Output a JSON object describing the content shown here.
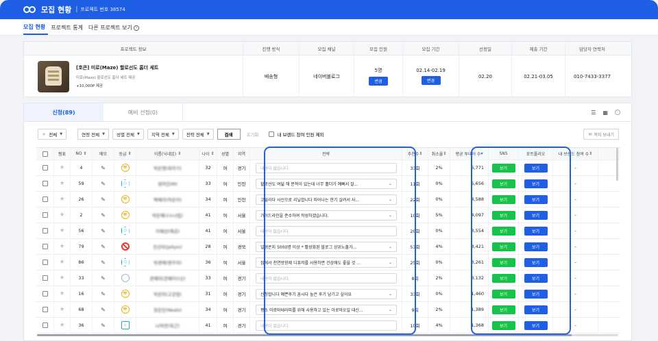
{
  "header": {
    "title": "모집 현황",
    "separator": "|",
    "project_no": "프로젝트 번호 38574"
  },
  "nav": {
    "tabs": [
      {
        "label": "모집 현황"
      },
      {
        "label": "프로젝트 통계"
      },
      {
        "label": "다른 프로젝트 보기"
      }
    ],
    "more_icon": "chevron-right-circle-icon"
  },
  "info": {
    "headers": [
      "프로젝트 정보",
      "진행 방식",
      "모집 채널",
      "모집 인원",
      "모집 기간",
      "선정일",
      "제출 기간",
      "담당자 연락처"
    ],
    "product_name": "[호큰] 미로(Maze) 할로선도 홈더 세트",
    "product_sub": "미로(Maze) 할로선도 홈더 세트 제공",
    "product_point": "+10,000P 제공",
    "method": "배송형",
    "channel": "네이버블로그",
    "recruit": "5명",
    "recruit_btn": "변경",
    "period": "02.14-02.19",
    "period_btn": "변경",
    "select_date": "02.20",
    "submit_period": "02.21-03.05",
    "contact": "010-7433-3377"
  },
  "tabs": {
    "apply": "신청(89)",
    "preselect": "예비 선정(0)",
    "icons": [
      "list-view-icon",
      "grid-view-icon",
      "info-icon"
    ]
  },
  "filters": {
    "fav": "전체",
    "connect": "연령 전체",
    "gender": "성별 전체",
    "region": "지역 전체",
    "reason": "전략 전체",
    "search": "검색",
    "reset": "초기화",
    "exclude": "내 브랜드 참여 인원 제외",
    "message": "쪽지 보내기"
  },
  "columns": [
    "",
    "찜표",
    "NO",
    "메모",
    "등급",
    "이름(닉네임)",
    "나이",
    "성별",
    "지역",
    "전략",
    "추천수",
    "취소율",
    "평균 투데이 수",
    "SNS",
    "포트폴리오",
    "내 브랜드 참여 수"
  ],
  "rows": [
    {
      "no": "4",
      "grade": "gold",
      "name": "박은영(육아기)",
      "age": "32",
      "sex": "여",
      "region": "경기",
      "reason": "내용이 없습니다.",
      "empty": true,
      "rec": "33회",
      "cancel": "2%",
      "avg": "6,771",
      "sns": "보기",
      "pf": "보기",
      "brand": "-"
    },
    {
      "no": "59",
      "grade": "teal",
      "name": "정여진(M)",
      "age": "33",
      "sex": "여",
      "region": "인천",
      "reason": "할로선도 여덟 해 분적이 있는데 너무 홀더가 예뻐서 잘...",
      "empty": false,
      "rec": "11회",
      "cancel": "0%",
      "avg": "5,656",
      "sns": "보기",
      "pf": "보기",
      "brand": "-"
    },
    {
      "no": "26",
      "grade": "gold",
      "name": "백예리(하은이)",
      "age": "34",
      "sex": "여",
      "region": "인천",
      "reason": "고릴리다 사신으로 리닐합니다 피어나는 한기 살려서 사...",
      "empty": false,
      "rec": "22회",
      "cancel": "0%",
      "avg": "4,588",
      "sns": "보기",
      "pf": "보기",
      "brand": "-"
    },
    {
      "no": "2",
      "grade": "gold",
      "name": "박은혜(1누나립)",
      "age": "41",
      "sex": "여",
      "region": "서울",
      "reason": "가이드라인을 준수하여 작성하겠습니다.",
      "empty": false,
      "rec": "10회",
      "cancel": "5%",
      "avg": "4,097",
      "sns": "보기",
      "pf": "보기",
      "brand": "-"
    },
    {
      "no": "56",
      "grade": "teal",
      "name": "이혜선(해공)",
      "age": "41",
      "sex": "여",
      "region": "서울",
      "reason": "내용이 없습니다.",
      "empty": true,
      "rec": "20회",
      "cancel": "0%",
      "avg": "3,554",
      "sns": "보기",
      "pf": "보기",
      "brand": "-"
    },
    {
      "no": "79",
      "grade": "ban",
      "name": "민강미(jellyin)",
      "age": "28",
      "sex": "여",
      "region": "경북",
      "reason": "일생은지 5000명 이상 * 활성화된 블로그 상위노출가...",
      "empty": false,
      "rec": "53회",
      "cancel": "4%",
      "avg": "3,421",
      "sns": "보기",
      "pf": "보기",
      "brand": "-"
    },
    {
      "no": "86",
      "grade": "teal",
      "name": "박경애(영주아)",
      "age": "36",
      "sex": "여",
      "region": "서울",
      "reason": "집에서 천연방향제 디퓨저를 사용하면 건강에도 좋을 것 ...",
      "empty": false,
      "rec": "25회",
      "cancel": "0%",
      "avg": "3,261",
      "sns": "보기",
      "pf": "보기",
      "brand": "-"
    },
    {
      "no": "33",
      "grade": "gray",
      "name": "관예미(콘페이)(신)",
      "age": "33",
      "sex": "여",
      "region": "경기",
      "reason": "내용이 없습니다.",
      "empty": true,
      "rec": "8회",
      "cancel": "2%",
      "avg": "3,132",
      "sns": "보기",
      "pf": "보기",
      "brand": "-"
    },
    {
      "no": "16",
      "grade": "gold",
      "name": "박은미(고궁엄)",
      "age": "31",
      "sex": "여",
      "region": "경기",
      "reason": "신청합니다 예쁜후기 꼼시다 높은 후기 남기고 싶어요",
      "empty": false,
      "rec": "33회",
      "cancel": "0%",
      "avg": "1,460",
      "sns": "보기",
      "pf": "보기",
      "brand": "-"
    },
    {
      "no": "68",
      "grade": "gold",
      "name": "정은진(Neals)",
      "age": "34",
      "sex": "여",
      "region": "경기",
      "reason": "평소 아로마테라피를 위해 사용하고 있는 아로마오일 대신...",
      "empty": false,
      "rec": "9회",
      "cancel": "2%",
      "avg": "1,389",
      "sns": "보기",
      "pf": "보기",
      "brand": "-"
    },
    {
      "no": "36",
      "grade": "teal_s",
      "name": "나하연(육근)",
      "age": "41",
      "sex": "여",
      "region": "경기",
      "reason": "내용이 없습니다.",
      "empty": true,
      "rec": "10회",
      "cancel": "4%",
      "avg": "1,368",
      "sns": "보기",
      "pf": "보기",
      "brand": "-"
    }
  ]
}
